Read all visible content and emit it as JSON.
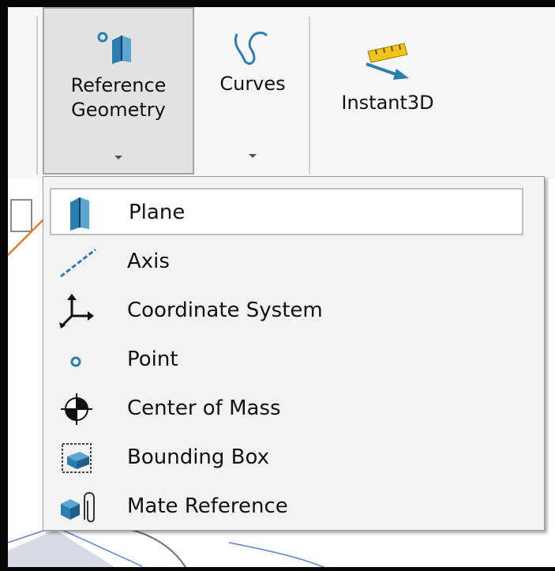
{
  "ribbon": {
    "buttons": [
      {
        "label": "Reference\nGeometry",
        "has_dropdown": true,
        "active": true
      },
      {
        "label": "Curves",
        "has_dropdown": true,
        "active": false
      },
      {
        "label": "Instant3D",
        "has_dropdown": false,
        "active": false
      }
    ]
  },
  "menu": {
    "items": [
      {
        "label": "Plane",
        "icon": "plane-icon",
        "highlighted": true
      },
      {
        "label": "Axis",
        "icon": "axis-icon"
      },
      {
        "label": "Coordinate System",
        "icon": "coordinate-system-icon"
      },
      {
        "label": "Point",
        "icon": "point-icon"
      },
      {
        "label": "Center of Mass",
        "icon": "center-of-mass-icon"
      },
      {
        "label": "Bounding Box",
        "icon": "bounding-box-icon"
      },
      {
        "label": "Mate Reference",
        "icon": "mate-reference-icon"
      }
    ]
  },
  "annotation": {
    "arrow_color": "#e07b2c"
  },
  "colors": {
    "frame": "#050505",
    "menu_bg": "#f3f3f3",
    "icon_blue": "#2b7fb0"
  }
}
